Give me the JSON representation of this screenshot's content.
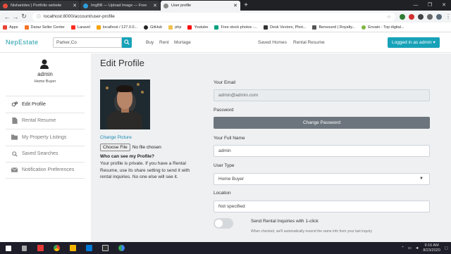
{
  "browser": {
    "tabs": [
      {
        "title": "Nishantdev | Portfolio website",
        "active": false,
        "favicon_color": "#e74c3c"
      },
      {
        "title": "ImgBB — Upload Image — Free",
        "active": false,
        "favicon_color": "#2d9cdb"
      },
      {
        "title": "User profile",
        "active": true,
        "favicon_color": "#888888"
      }
    ],
    "new_tab": "+",
    "window_controls": [
      "—",
      "❐",
      "✕"
    ],
    "url": "localhost:8000/account/user-profile",
    "bookmarks": [
      {
        "label": "Apps",
        "color": "#ea4335"
      },
      {
        "label": "Daraz Seller Center",
        "color": "#f57224"
      },
      {
        "label": "Laravel",
        "color": "#ff2d20"
      },
      {
        "label": "localhost / 127.0.0...",
        "color": "#f4a300"
      },
      {
        "label": "GitHub",
        "color": "#222222"
      },
      {
        "label": "php",
        "color": "#777bb3"
      },
      {
        "label": "Youtube",
        "color": "#ff0000"
      },
      {
        "label": "Free stock photos -...",
        "color": "#05a081"
      },
      {
        "label": "Desk Vectors, Phot...",
        "color": "#333333"
      },
      {
        "label": "Bensound | Royalty...",
        "color": "#555555"
      },
      {
        "label": "Envato - Top digital...",
        "color": "#82b541"
      }
    ]
  },
  "site": {
    "brand": "NepEstate",
    "search_placeholder": "Parker,Co",
    "nav_left": [
      "Buy",
      "Rent",
      "Mortage"
    ],
    "nav_right": [
      "Saved Homes",
      "Rental Resume"
    ],
    "login_label": "Logged in as admin ▾",
    "accent": "#17a2b8"
  },
  "sidebar": {
    "name": "admin",
    "role": "Home Buyer",
    "items": [
      {
        "label": "Edit Profile",
        "icon": "gears-icon",
        "active": true
      },
      {
        "label": "Rental Resume",
        "icon": "file-icon",
        "active": false
      },
      {
        "label": "My Property Listings",
        "icon": "folder-icon",
        "active": false
      },
      {
        "label": "Saved Searches",
        "icon": "search-icon",
        "active": false
      },
      {
        "label": "Notification Preferences",
        "icon": "envelope-icon",
        "active": false
      }
    ]
  },
  "profile": {
    "title": "Edit Profile",
    "change_picture": "Change Picture",
    "file_button": "Choose File",
    "file_status": "No file chosen",
    "privacy_title": "Who can see my Profile?",
    "privacy_text": "Your profile is private. If you have a Rental Resume, use its share setting to send it with rental inquiries. No one else will see it.",
    "email_label": "Your Email",
    "email_value": "admin@admin.com",
    "password_label": "Password",
    "password_button": "Change Password",
    "name_label": "Your Full Name",
    "name_value": "admin",
    "user_type_label": "User Type",
    "user_type_value": "Home Buyer",
    "location_label": "Location",
    "location_value": "Not specified",
    "toggle_label": "Send Rental Inquiries with 1-click",
    "toggle_on": false,
    "toggle_help": "When checked, we'll automatically resend the same info from your last inquiry"
  },
  "taskbar": {
    "apps": [
      "#ffffff",
      "#d8d8d8",
      "#e53935",
      "#fbbc05",
      "#f4b400",
      "#0078d7",
      "#cccccc",
      "#4285f4"
    ],
    "time": "9:16 AM",
    "date": "8/23/2020"
  }
}
